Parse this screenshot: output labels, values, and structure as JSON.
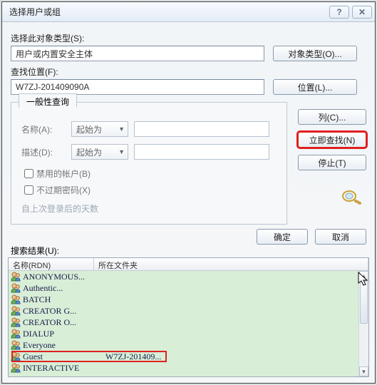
{
  "title": "选择用户或组",
  "section1_label": "选择此对象类型(S):",
  "section1_value": "用户或内置安全主体",
  "btn_object_types": "对象类型(O)...",
  "section2_label": "查找位置(F):",
  "section2_value": "W7ZJ-201409090A",
  "btn_locations": "位置(L)...",
  "tab_label": "一般性查询",
  "q_name": "名称(A):",
  "q_desc": "描述(D):",
  "combo_value": "起始为",
  "chk_disabled": "禁用的帐户(B)",
  "chk_noexpire": "不过期密码(X)",
  "dim_lastlogin": "自上次登录后的天数",
  "btn_columns": "列(C)...",
  "btn_findnow": "立即查找(N)",
  "btn_stop": "停止(T)",
  "btn_ok": "确定",
  "btn_cancel": "取消",
  "search_results_label": "搜索结果(U):",
  "col_name": "名称(RDN)",
  "col_folder": "所在文件夹",
  "rows": [
    {
      "name": "ANONYMOUS...",
      "folder": ""
    },
    {
      "name": "Authentic...",
      "folder": ""
    },
    {
      "name": "BATCH",
      "folder": ""
    },
    {
      "name": "CREATOR G...",
      "folder": ""
    },
    {
      "name": "CREATOR O...",
      "folder": ""
    },
    {
      "name": "DIALUP",
      "folder": ""
    },
    {
      "name": "Everyone",
      "folder": ""
    },
    {
      "name": "Guest",
      "folder": "W7ZJ-201409..."
    },
    {
      "name": "INTERACTIVE",
      "folder": ""
    }
  ],
  "highlighted_index": 7
}
